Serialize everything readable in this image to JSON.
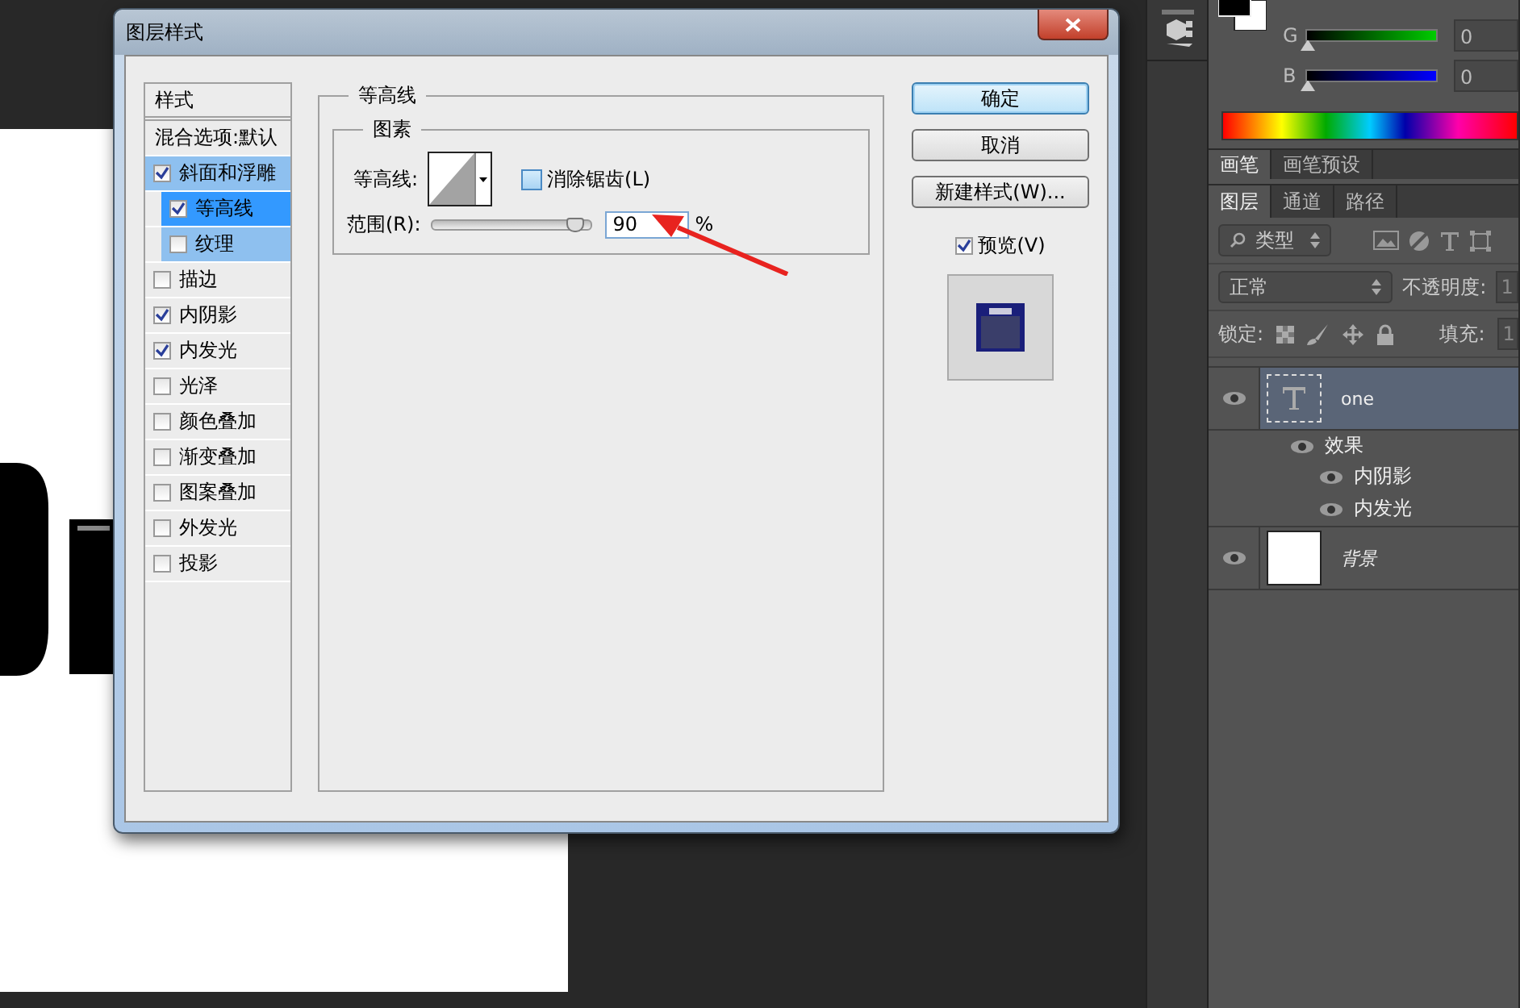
{
  "dialog": {
    "title": "图层样式",
    "styles_header": "样式",
    "blend_options": "混合选项:默认",
    "styles": [
      {
        "label": "斜面和浮雕",
        "checked": true,
        "selected": false,
        "children": [
          {
            "label": "等高线",
            "checked": true,
            "selected": true
          },
          {
            "label": "纹理",
            "checked": false,
            "selected": false
          }
        ]
      },
      {
        "label": "描边",
        "checked": false,
        "selected": false
      },
      {
        "label": "内阴影",
        "checked": true,
        "selected": false
      },
      {
        "label": "内发光",
        "checked": true,
        "selected": false
      },
      {
        "label": "光泽",
        "checked": false,
        "selected": false
      },
      {
        "label": "颜色叠加",
        "checked": false,
        "selected": false
      },
      {
        "label": "渐变叠加",
        "checked": false,
        "selected": false
      },
      {
        "label": "图案叠加",
        "checked": false,
        "selected": false
      },
      {
        "label": "外发光",
        "checked": false,
        "selected": false
      },
      {
        "label": "投影",
        "checked": false,
        "selected": false
      }
    ],
    "group_title": "等高线",
    "subgroup_title": "图素",
    "contour_label": "等高线:",
    "anti_alias": {
      "label": "消除锯齿(L)",
      "checked": false
    },
    "range": {
      "label": "范围(R):",
      "level": 0.9,
      "value": "90",
      "unit": "%"
    },
    "buttons": [
      {
        "label": "确定",
        "default": true
      },
      {
        "label": "取消",
        "default": false
      },
      {
        "label": "新建样式(W)...",
        "default": false
      }
    ],
    "preview": {
      "label": "预览(V)",
      "checked": true
    }
  },
  "color_panel": {
    "channels": [
      {
        "label": "G",
        "level": 0,
        "value": "0"
      },
      {
        "label": "B",
        "level": 0,
        "value": "0"
      }
    ]
  },
  "panel_tabs": [
    {
      "label": "画笔",
      "selected": true
    },
    {
      "label": "画笔预设",
      "selected": false
    }
  ],
  "layer_tabs": [
    {
      "label": "图层",
      "selected": true
    },
    {
      "label": "通道",
      "selected": false
    },
    {
      "label": "路径",
      "selected": false
    }
  ],
  "layers_panel": {
    "filter": "类型",
    "blend_mode": "正常",
    "opacity_label": "不透明度:",
    "opacity": "1",
    "lock_label": "锁定:",
    "fill_label": "填充:",
    "fill": "1",
    "layers": [
      {
        "name": "one",
        "kind": "text",
        "selected": true,
        "visible": true,
        "effects_label": "效果",
        "effects": [
          {
            "name": "内阴影",
            "visible": true
          },
          {
            "name": "内发光",
            "visible": true
          }
        ]
      },
      {
        "name": "背景",
        "kind": "background",
        "selected": false,
        "visible": true
      }
    ]
  }
}
